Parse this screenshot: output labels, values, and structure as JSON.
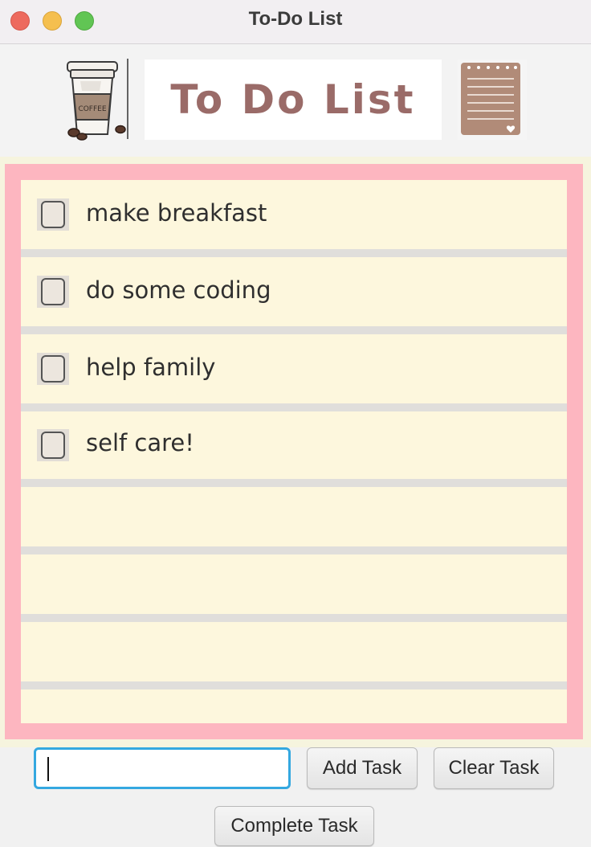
{
  "window": {
    "title": "To-Do List"
  },
  "header": {
    "banner_text": "To Do List",
    "coffee_cup_text": "COFFEE",
    "coffee_icon": "coffee-cup-icon",
    "notepad_icon": "notepad-icon"
  },
  "list": {
    "tasks": [
      {
        "label": "make breakfast",
        "checked": false
      },
      {
        "label": "do some coding",
        "checked": false
      },
      {
        "label": "help family",
        "checked": false
      },
      {
        "label": "self care!",
        "checked": false
      }
    ]
  },
  "controls": {
    "input_value": "",
    "input_placeholder": "",
    "add_label": "Add Task",
    "clear_label": "Clear Task",
    "complete_label": "Complete Task"
  },
  "colors": {
    "frame_pink": "#fdb6c0",
    "list_cream": "#fdf7dd",
    "separator_gray": "#e0dedb",
    "input_focus_blue": "#34a8e0",
    "banner_text": "#9a6b68"
  }
}
